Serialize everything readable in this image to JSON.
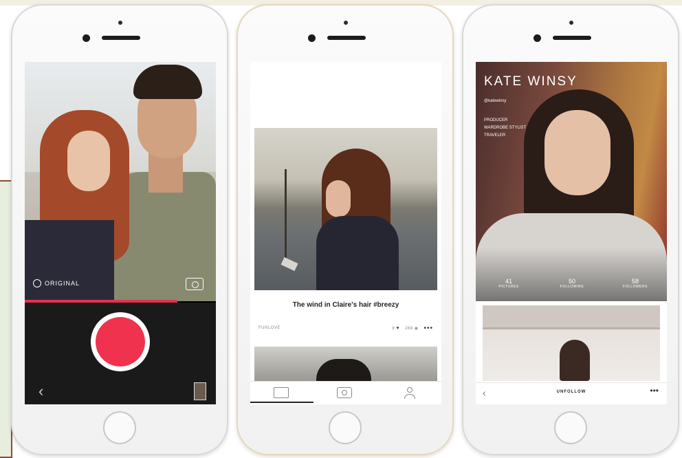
{
  "phone1": {
    "mode_label": "ORIGINAL",
    "icons": [
      "original-mode-icon",
      "flip-camera-icon",
      "back-chevron-icon"
    ],
    "record_color": "#f0324f",
    "progress_fraction": 0.8
  },
  "phone2": {
    "caption": "The wind in Claire's hair #breezy",
    "author": "FUNLOVE",
    "likes": "8",
    "views": "268",
    "more": "•••",
    "tabs": [
      "home-tab",
      "camera-tab",
      "profile-tab"
    ]
  },
  "phone3": {
    "name": "KATE WINSY",
    "handle": "@katewinsy",
    "bio": [
      "PRODUCER",
      "WARDROBE STYLIST",
      "TRAVELER"
    ],
    "stats": [
      {
        "value": "41",
        "label": "PICTURES"
      },
      {
        "value": "50",
        "label": "FOLLOWING"
      },
      {
        "value": "58",
        "label": "FOLLOWERS"
      }
    ],
    "unfollow": "UNFOLLOW",
    "more": "•••",
    "back": "‹"
  }
}
